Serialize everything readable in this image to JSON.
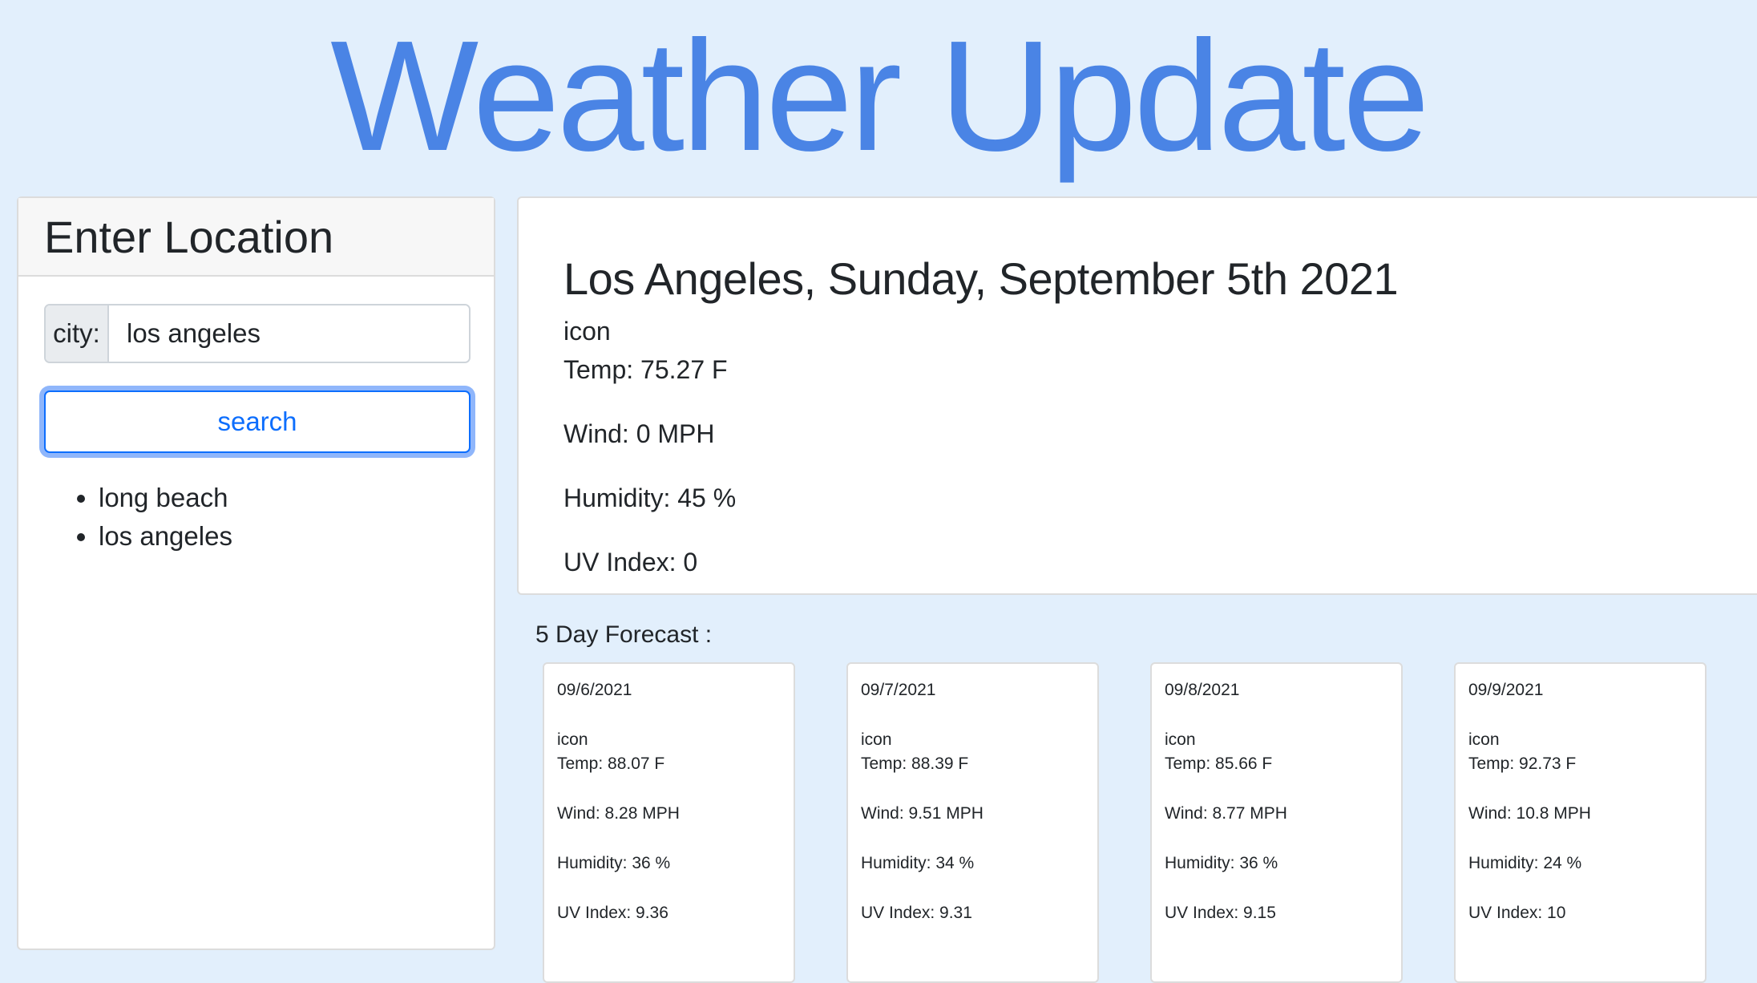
{
  "header": {
    "title": "Weather Update"
  },
  "search_panel": {
    "heading": "Enter Location",
    "city_label": "city:",
    "city_value": "los angeles",
    "search_label": "search",
    "history": [
      "long beach",
      "los angeles"
    ]
  },
  "current": {
    "heading": "Los Angeles, Sunday, September 5th 2021",
    "icon": "icon",
    "temp": "Temp: 75.27 F",
    "wind": "Wind: 0 MPH",
    "humidity": "Humidity: 45 %",
    "uv": "UV Index: 0"
  },
  "forecast": {
    "title": "5 Day Forecast :",
    "days": [
      {
        "date": "09/6/2021",
        "icon": "icon",
        "temp": "Temp: 88.07 F",
        "wind": "Wind: 8.28 MPH",
        "humidity": "Humidity: 36 %",
        "uv": "UV Index: 9.36"
      },
      {
        "date": "09/7/2021",
        "icon": "icon",
        "temp": "Temp: 88.39 F",
        "wind": "Wind: 9.51 MPH",
        "humidity": "Humidity: 34 %",
        "uv": "UV Index: 9.31"
      },
      {
        "date": "09/8/2021",
        "icon": "icon",
        "temp": "Temp: 85.66 F",
        "wind": "Wind: 8.77 MPH",
        "humidity": "Humidity: 36 %",
        "uv": "UV Index: 9.15"
      },
      {
        "date": "09/9/2021",
        "icon": "icon",
        "temp": "Temp: 92.73 F",
        "wind": "Wind: 10.8 MPH",
        "humidity": "Humidity: 24 %",
        "uv": "UV Index: 10"
      }
    ]
  },
  "colors": {
    "page_background": "#e2effc",
    "title_blue": "#4a84e5",
    "button_blue": "#0d6efd"
  }
}
